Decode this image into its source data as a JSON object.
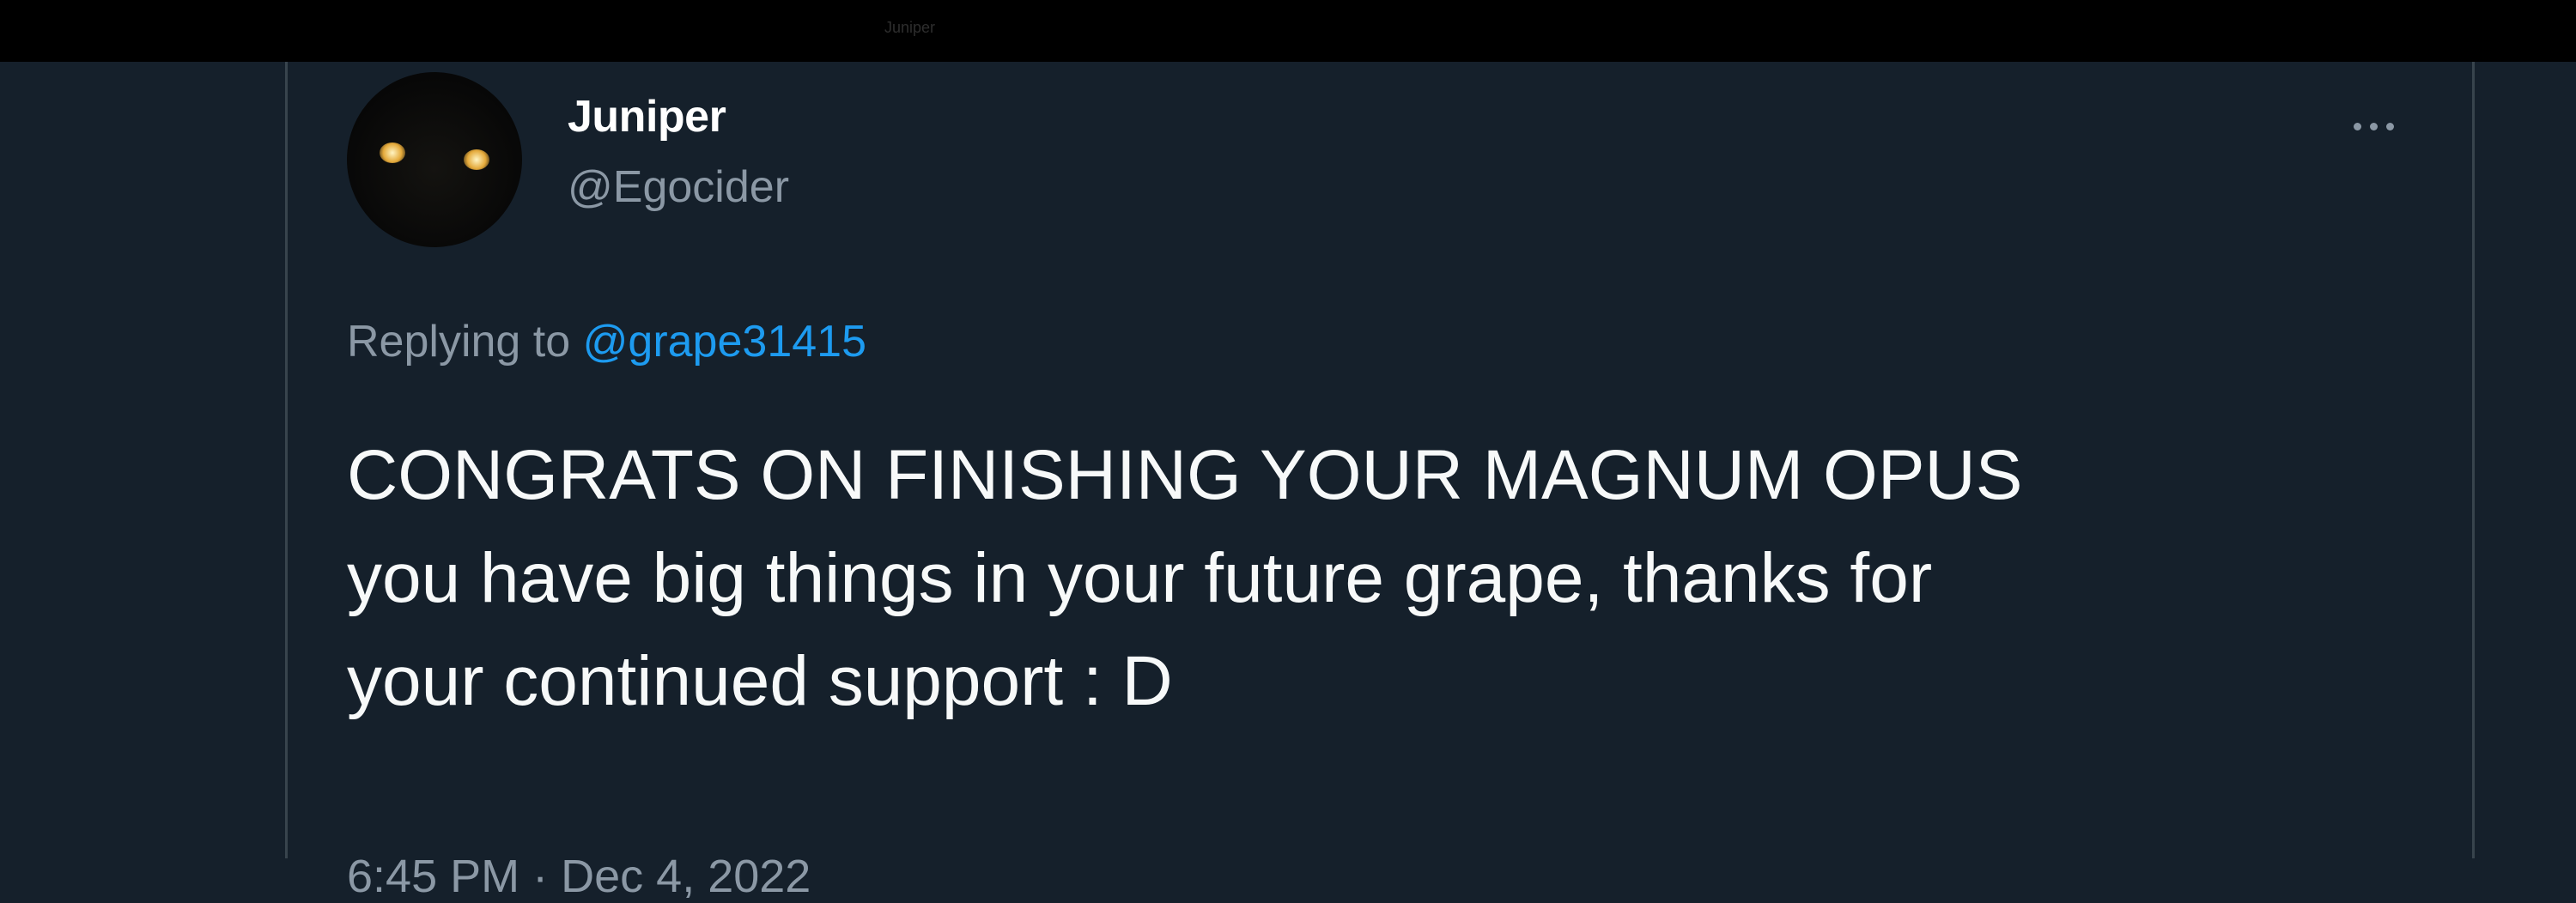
{
  "topbar": {
    "ghost_name": "Juniper"
  },
  "tweet": {
    "author": {
      "display_name": "Juniper",
      "handle": "@Egocider"
    },
    "reply": {
      "prefix": "Replying to",
      "target": "@grape31415"
    },
    "lines": [
      "CONGRATS ON FINISHING YOUR MAGNUM OPUS",
      "you have big things in your future grape, thanks for",
      "your continued support : D"
    ],
    "time": "6:45 PM",
    "separator": "·",
    "date": "Dec 4, 2022",
    "more_icon": "ellipsis-icon"
  },
  "colors": {
    "background": "#15202b",
    "text": "#f7f9f9",
    "secondary": "#8b98a5",
    "link": "#1d9bf0",
    "border": "#38444d"
  }
}
